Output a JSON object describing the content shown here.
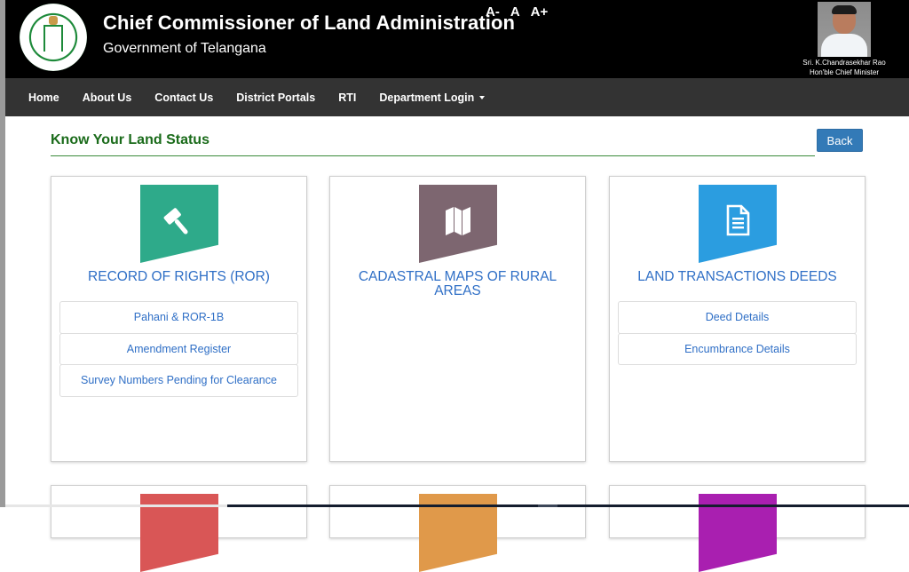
{
  "header": {
    "title": "Chief Commissioner of Land Administration",
    "subtitle": "Government of Telangana",
    "font_controls": [
      "A-",
      "A",
      "A+"
    ],
    "emblem_alt": "Government of Telangana emblem",
    "chief_minister": {
      "name": "Sri. K.Chandrasekhar Rao",
      "designation": "Hon'ble Chief Minister"
    }
  },
  "nav": {
    "items": [
      {
        "label": "Home"
      },
      {
        "label": "About Us"
      },
      {
        "label": "Contact Us"
      },
      {
        "label": "District Portals"
      },
      {
        "label": "RTI"
      },
      {
        "label": "Department Login",
        "dropdown": true
      }
    ]
  },
  "page": {
    "title": "Know Your Land Status",
    "back_label": "Back"
  },
  "cards": [
    {
      "title": "RECORD OF RIGHTS (ROR)",
      "icon": "gavel-icon",
      "color": "#2eaa8a",
      "links": [
        "Pahani & ROR-1B",
        "Amendment Register",
        "Survey Numbers Pending for Clearance"
      ]
    },
    {
      "title": "CADASTRAL MAPS OF RURAL AREAS",
      "icon": "map-icon",
      "color": "#7d6670",
      "links": []
    },
    {
      "title": "LAND TRANSACTIONS DEEDS",
      "icon": "document-icon",
      "color": "#2b9de0",
      "links": [
        "Deed Details",
        "Encumbrance Details"
      ]
    }
  ],
  "next_row_colors": [
    "#d95656",
    "#e0994a",
    "#a91fb0"
  ],
  "colors": {
    "header_bg": "#000000",
    "nav_bg": "#333333",
    "title_green": "#1a6b1a",
    "link_blue": "#2f6fc6",
    "button_blue": "#337ab7"
  }
}
